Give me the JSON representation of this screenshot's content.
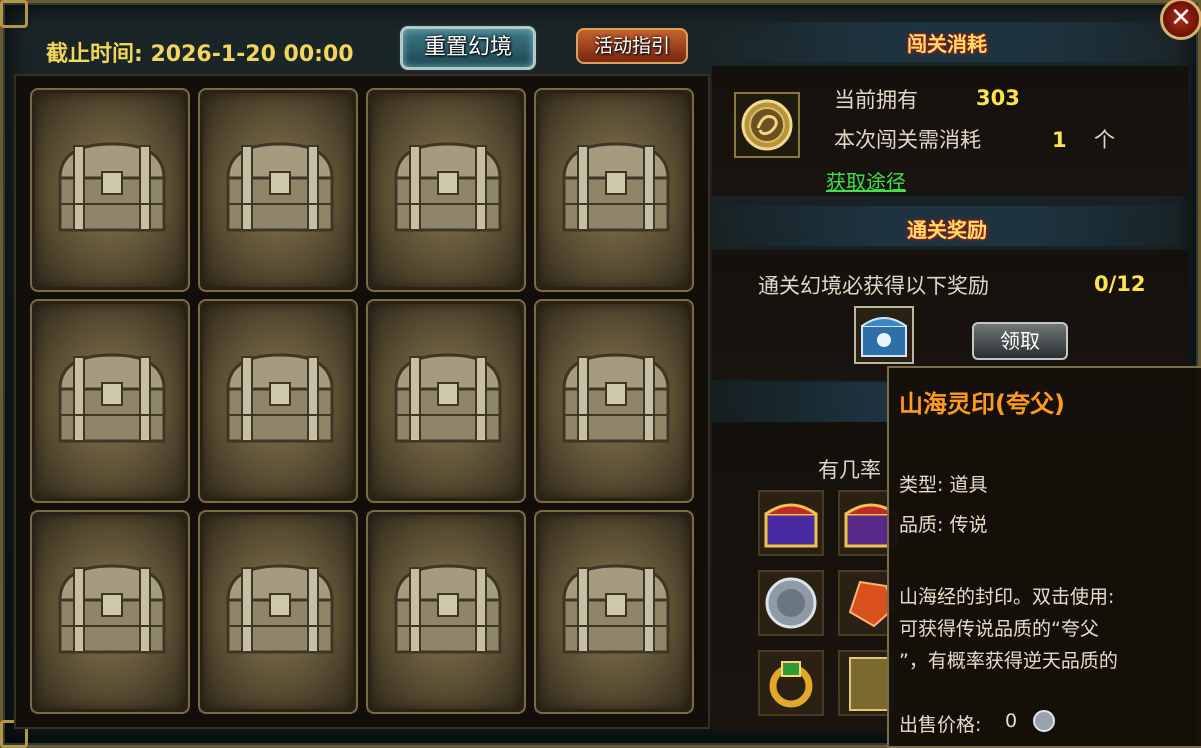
{
  "header": {
    "deadline": "截止时间: 2026-1-20 00:00",
    "reset_button": "重置幻境",
    "guide_button": "活动指引"
  },
  "grid": {
    "rows": 3,
    "cols": 4,
    "cards": [
      "chest",
      "chest",
      "chest",
      "chest",
      "chest",
      "chest",
      "chest",
      "chest",
      "chest",
      "chest",
      "chest",
      "chest"
    ]
  },
  "cost": {
    "title": "闯关消耗",
    "owned_label": "当前拥有",
    "owned_value": "303",
    "need_label": "本次闯关需消耗",
    "need_value": "1",
    "unit": "个",
    "obtain_link": "获取途径"
  },
  "reward": {
    "title": "通关奖励",
    "desc": "通关幻境必获得以下奖励",
    "progress": "0/12",
    "claim_button": "领取"
  },
  "chance": {
    "partial_label": "有几率"
  },
  "tooltip": {
    "name": "山海灵印(夸父)",
    "type_label": "类型: 道具",
    "quality_label": "品质: 传说",
    "desc_line1": "山海经的封印。双击使用:",
    "desc_line2": "可获得传说品质的“夸父",
    "desc_line3": "”，有概率获得逆天品质的",
    "price_label": "出售价格:",
    "price_value": "0"
  },
  "colors": {
    "accent_gold": "#ffdc6a",
    "value_yellow": "#ffe34a",
    "link_green": "#3fe04a",
    "tooltip_title": "#ff9a1e"
  },
  "icons": {
    "close": "close-icon",
    "coin": "seal-coin-icon",
    "chest": "treasure-chest-icon"
  }
}
